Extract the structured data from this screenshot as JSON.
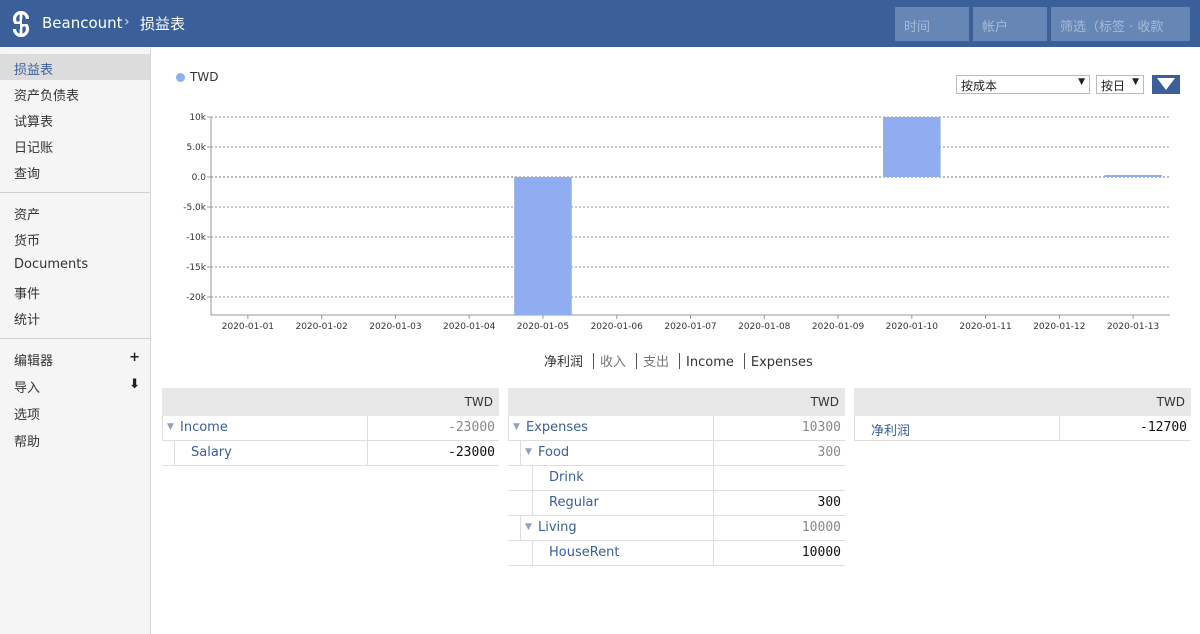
{
  "header": {
    "brand": "Beancount",
    "separator": "›",
    "page_title": "损益表",
    "time_placeholder": "时间",
    "account_placeholder": "帐户",
    "filter_placeholder": "筛选（标签 · 收款"
  },
  "sidebar": {
    "group1": [
      "损益表",
      "资产负债表",
      "试算表",
      "日记账",
      "查询"
    ],
    "group2": [
      "资产",
      "货币",
      "Documents",
      "事件",
      "统计"
    ],
    "group3": [
      "编辑器",
      "导入",
      "选项",
      "帮助"
    ],
    "editor_mark": "+",
    "import_mark": "⬇"
  },
  "chart_controls": {
    "conversion": "按成本",
    "interval": "按日",
    "caret": "▼"
  },
  "chart_data": {
    "type": "bar",
    "legend": [
      "TWD"
    ],
    "categories": [
      "2020-01-01",
      "2020-01-02",
      "2020-01-03",
      "2020-01-04",
      "2020-01-05",
      "2020-01-06",
      "2020-01-07",
      "2020-01-08",
      "2020-01-09",
      "2020-01-10",
      "2020-01-11",
      "2020-01-12",
      "2020-01-13"
    ],
    "series": [
      {
        "name": "TWD",
        "values": [
          0,
          0,
          0,
          0,
          -23000,
          0,
          0,
          0,
          0,
          10000,
          0,
          0,
          300
        ],
        "color": "#8fadf0"
      }
    ],
    "y_ticks": [
      "10k",
      "5.0k",
      "0.0",
      "-5.0k",
      "-10k",
      "-15k",
      "-20k"
    ],
    "y_tick_values": [
      10000,
      5000,
      0,
      -5000,
      -10000,
      -15000,
      -20000
    ],
    "ylim": [
      -23000,
      10000
    ],
    "grid": true,
    "legend_position": "top-left"
  },
  "chart_modes": [
    "净利润",
    "收入",
    "支出",
    "Income",
    "Expenses"
  ],
  "tables": {
    "currency": "TWD",
    "income": [
      {
        "name": "Income",
        "value": "-23000",
        "level": 0,
        "expandable": true,
        "muted": true
      },
      {
        "name": "Salary",
        "value": "-23000",
        "level": 1,
        "expandable": false,
        "muted": false
      }
    ],
    "expenses": [
      {
        "name": "Expenses",
        "value": "10300",
        "level": 0,
        "expandable": true,
        "muted": true
      },
      {
        "name": "Food",
        "value": "300",
        "level": 1,
        "expandable": true,
        "muted": true
      },
      {
        "name": "Drink",
        "value": "",
        "level": 2,
        "expandable": false,
        "muted": false
      },
      {
        "name": "Regular",
        "value": "300",
        "level": 2,
        "expandable": false,
        "muted": false
      },
      {
        "name": "Living",
        "value": "10000",
        "level": 1,
        "expandable": true,
        "muted": true
      },
      {
        "name": "HouseRent",
        "value": "10000",
        "level": 2,
        "expandable": false,
        "muted": false
      }
    ],
    "net": [
      {
        "name": "净利润",
        "value": "-12700",
        "level": 0,
        "expandable": false,
        "muted": false
      }
    ]
  }
}
